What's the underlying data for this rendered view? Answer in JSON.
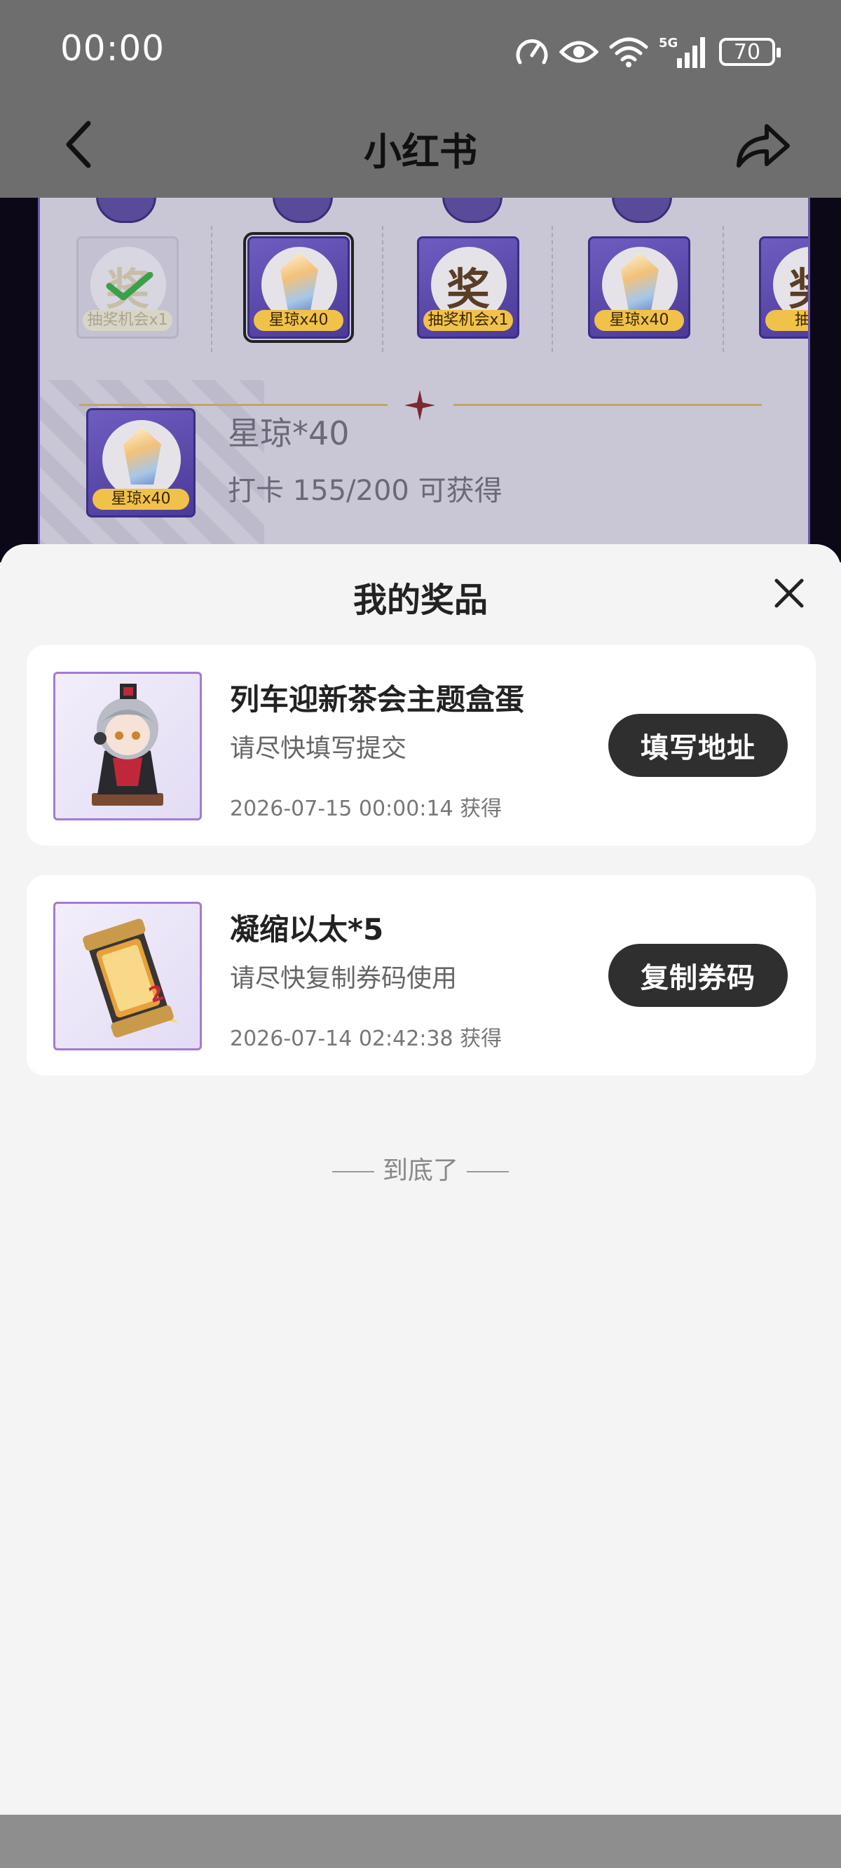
{
  "status_bar": {
    "time": "00:00",
    "battery": "70",
    "network": "5G"
  },
  "nav": {
    "title": "小红书",
    "back_icon": "chevron-left-icon",
    "share_icon": "share-arrow-icon"
  },
  "background_page": {
    "reward_tiles": [
      {
        "label": "抽奖机会x1",
        "glyph": "奖",
        "state": "claimed"
      },
      {
        "label": "星琼x40",
        "glyph": "",
        "state": "selected"
      },
      {
        "label": "抽奖机会x1",
        "glyph": "奖",
        "state": "locked"
      },
      {
        "label": "星琼x40",
        "glyph": "",
        "state": "locked"
      },
      {
        "label": "抽奖",
        "glyph": "奖",
        "state": "locked"
      }
    ],
    "progress_item": {
      "tile_label": "星琼x40",
      "title": "星琼*40",
      "subtitle": "打卡 155/200 可获得"
    }
  },
  "sheet": {
    "title": "我的奖品",
    "close_icon": "close-icon",
    "prizes": [
      {
        "name": "列车迎新茶会主题盒蛋",
        "hint": "请尽快填写提交",
        "time": "2026-07-15 00:00:14 获得",
        "button": "填写地址"
      },
      {
        "name": "凝缩以太*5",
        "hint": "请尽快复制券码使用",
        "time": "2026-07-14 02:42:38 获得",
        "button": "复制券码"
      }
    ],
    "end_text": "到底了"
  }
}
